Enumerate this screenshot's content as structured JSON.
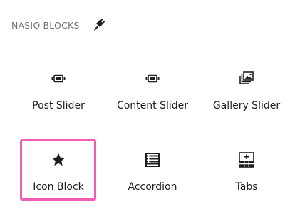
{
  "panel": {
    "title": "NASIO BLOCKS",
    "title_icon": "plug-icon"
  },
  "blocks": [
    {
      "label": "Post Slider",
      "icon": "slider-icon"
    },
    {
      "label": "Content Slider",
      "icon": "slider-icon"
    },
    {
      "label": "Gallery Slider",
      "icon": "gallery-icon"
    },
    {
      "label": "Icon Block",
      "icon": "star-icon",
      "highlighted": true
    },
    {
      "label": "Accordion",
      "icon": "accordion-icon"
    },
    {
      "label": "Tabs",
      "icon": "tabs-icon"
    }
  ],
  "colors": {
    "highlight": "#f15bb5",
    "text": "#1e1e1e",
    "muted": "#757575"
  }
}
